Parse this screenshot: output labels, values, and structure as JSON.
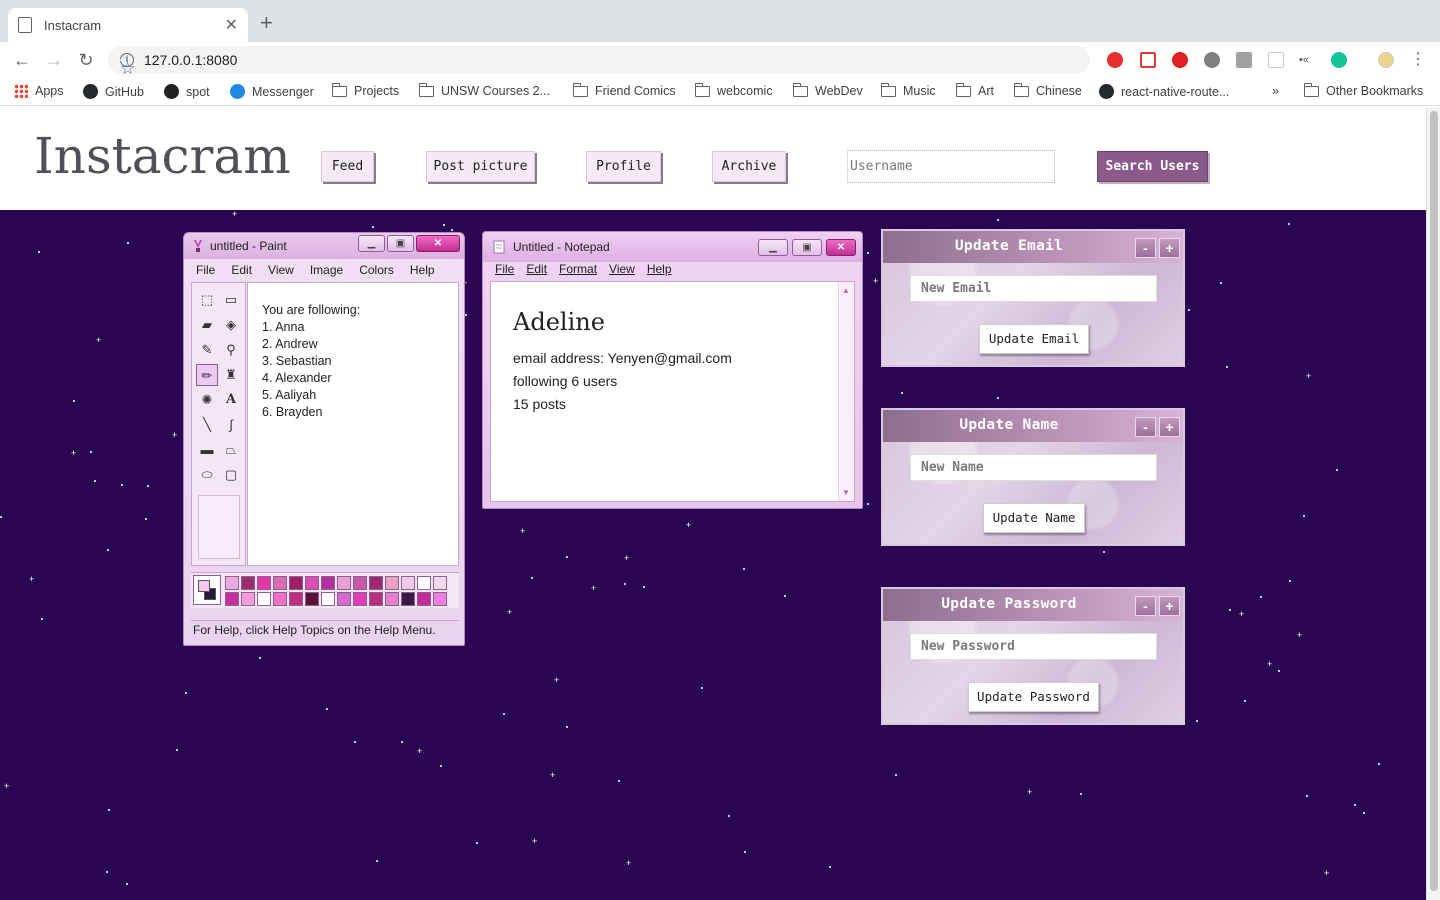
{
  "browser": {
    "tab_title": "Instacram",
    "url": "127.0.0.1:8080",
    "bookmarks": [
      {
        "label": "Apps",
        "icon": "apps-icon"
      },
      {
        "label": "GitHub",
        "icon": "github-icon"
      },
      {
        "label": "spot",
        "icon": "spotify-icon"
      },
      {
        "label": "Messenger",
        "icon": "messenger-icon"
      },
      {
        "label": "Projects",
        "icon": "folder-icon"
      },
      {
        "label": "UNSW Courses 2...",
        "icon": "folder-icon"
      },
      {
        "label": "Friend Comics",
        "icon": "folder-icon"
      },
      {
        "label": "webcomic",
        "icon": "folder-icon"
      },
      {
        "label": "WebDev",
        "icon": "folder-icon"
      },
      {
        "label": "Music",
        "icon": "folder-icon"
      },
      {
        "label": "Art",
        "icon": "folder-icon"
      },
      {
        "label": "Chinese",
        "icon": "folder-icon"
      },
      {
        "label": "react-native-route...",
        "icon": "github-icon"
      },
      {
        "label": "»",
        "icon": "overflow-chevron-icon"
      },
      {
        "label": "Other Bookmarks",
        "icon": "folder-icon"
      }
    ]
  },
  "site": {
    "logo": "Instacram",
    "nav": {
      "feed": "Feed",
      "post": "Post picture",
      "profile": "Profile",
      "archive": "Archive"
    },
    "search_placeholder": "Username",
    "search_button": "Search Users"
  },
  "paint": {
    "title": "untitled - Paint",
    "menu": [
      "File",
      "Edit",
      "View",
      "Image",
      "Colors",
      "Help"
    ],
    "following_heading": "You are following:",
    "following": [
      "1. Anna",
      "2. Andrew",
      "3. Sebastian",
      "4. Alexander",
      "5. Aaliyah",
      "6. Brayden"
    ],
    "status": "For Help, click Help Topics on the Help Menu."
  },
  "notepad": {
    "title": "Untitled - Notepad",
    "menu": [
      "File",
      "Edit",
      "Format",
      "View",
      "Help"
    ],
    "name": "Adeline",
    "email_line": "email address: Yenyen@gmail.com",
    "following_line": "following 6 users",
    "posts_line": "15 posts"
  },
  "panels": {
    "email": {
      "title": "Update Email",
      "placeholder": "New Email",
      "button": "Update Email"
    },
    "name": {
      "title": "Update Name",
      "placeholder": "New Name",
      "button": "Update Name"
    },
    "password": {
      "title": "Update Password",
      "placeholder": "New Password",
      "button": "Update Password"
    },
    "minimize_label": "-",
    "expand_label": "+"
  },
  "colors": {
    "space_bg": "#2a0652",
    "accent": "#8a5a8a",
    "palette": [
      "#e8a9dc",
      "#9c2f6f",
      "#e23aa8",
      "#d96bb7",
      "#9b2166",
      "#d84fb4",
      "#b3319c",
      "#e7a1d5",
      "#c65aa8",
      "#a02a6f",
      "#e8a3c4",
      "#f2c9e6",
      "#ffffff",
      "#f4d6ef",
      "#c52e9d",
      "#f59ce0",
      "#ffffff",
      "#ec71c7",
      "#c02b84",
      "#5a1535",
      "#ffffff",
      "#d46bd1",
      "#e33cbb",
      "#b72f7a",
      "#e582cf",
      "#3a1a46",
      "#c42b9d",
      "#f07ee0"
    ]
  }
}
